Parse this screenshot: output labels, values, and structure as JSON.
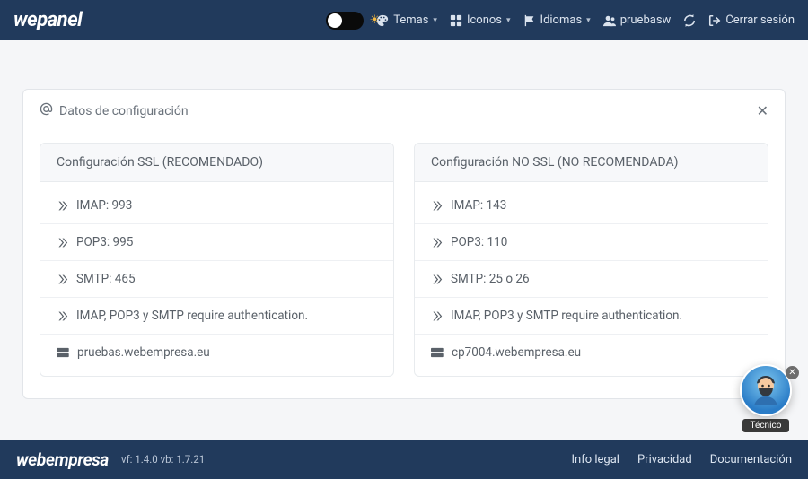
{
  "nav": {
    "brand": "wepanel",
    "themes": "Temas",
    "icons": "Iconos",
    "languages": "Idiomas",
    "user": "pruebasw",
    "logout": "Cerrar sesión"
  },
  "panel": {
    "title": "Datos de configuración"
  },
  "ssl": {
    "title": "Configuración SSL (RECOMENDADO)",
    "imap": "IMAP: 993",
    "pop3": "POP3: 995",
    "smtp": "SMTP: 465",
    "auth": "IMAP, POP3 y SMTP require authentication.",
    "server": "pruebas.webempresa.eu"
  },
  "nossl": {
    "title": "Configuración NO SSL (NO RECOMENDADA)",
    "imap": "IMAP: 143",
    "pop3": "POP3: 110",
    "smtp": "SMTP: 25 o 26",
    "auth": "IMAP, POP3 y SMTP require authentication.",
    "server": "cp7004.webempresa.eu"
  },
  "chat": {
    "label": "Técnico"
  },
  "footer": {
    "brand": "webempresa",
    "version": "vf: 1.4.0 vb: 1.7.21",
    "legal": "Info legal",
    "privacy": "Privacidad",
    "docs": "Documentación"
  }
}
